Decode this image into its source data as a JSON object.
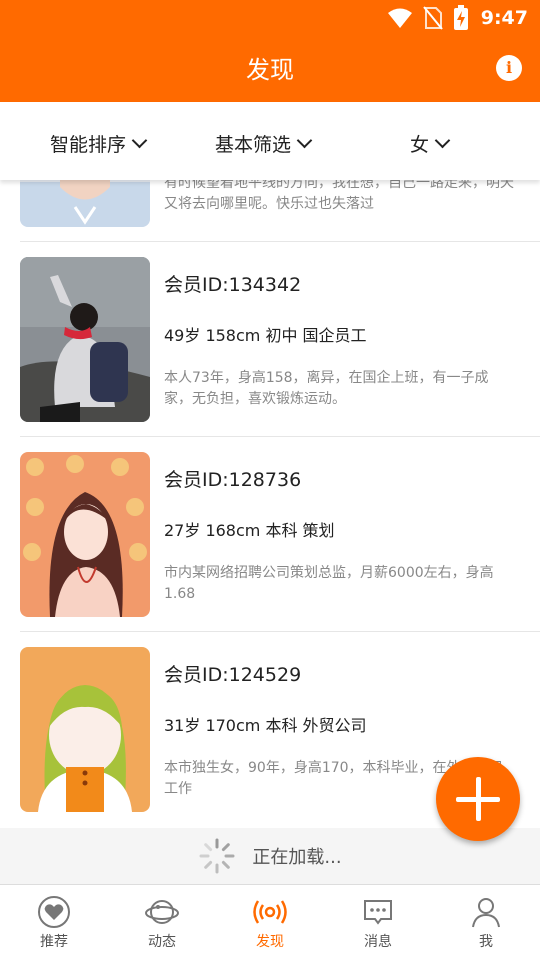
{
  "status": {
    "time": "9:47"
  },
  "header": {
    "title": "发现",
    "info_label": "i"
  },
  "filters": [
    {
      "label": "智能排序"
    },
    {
      "label": "基本筛选"
    },
    {
      "label": "女"
    }
  ],
  "partial_card": {
    "desc": "有时候望着地平线的方向，我在想，自己一路走来，明天又将去向哪里呢。快乐过也失落过"
  },
  "cards": [
    {
      "id": "会员ID:134342",
      "info": "49岁 158cm 初中 国企员工",
      "desc": "本人73年，身高158，离异，在国企上班，有一子成家，无负担，喜欢锻炼运动。"
    },
    {
      "id": "会员ID:128736",
      "info": "27岁 168cm 本科 策划",
      "desc": "市内某网络招聘公司策划总监，月薪6000左右，身高1.68"
    },
    {
      "id": "会员ID:124529",
      "info": "31岁 170cm 本科 外贸公司",
      "desc": "本市独生女，90年，身高170，本科毕业，在外贸公司工作"
    }
  ],
  "loading": {
    "text": "正在加载..."
  },
  "tabs": [
    {
      "label": "推荐",
      "icon": "heart-icon"
    },
    {
      "label": "动态",
      "icon": "planet-icon"
    },
    {
      "label": "发现",
      "icon": "broadcast-icon",
      "active": true
    },
    {
      "label": "消息",
      "icon": "message-icon"
    },
    {
      "label": "我",
      "icon": "person-icon"
    }
  ],
  "colors": {
    "accent": "#ff6a00",
    "text_secondary": "#888888"
  }
}
